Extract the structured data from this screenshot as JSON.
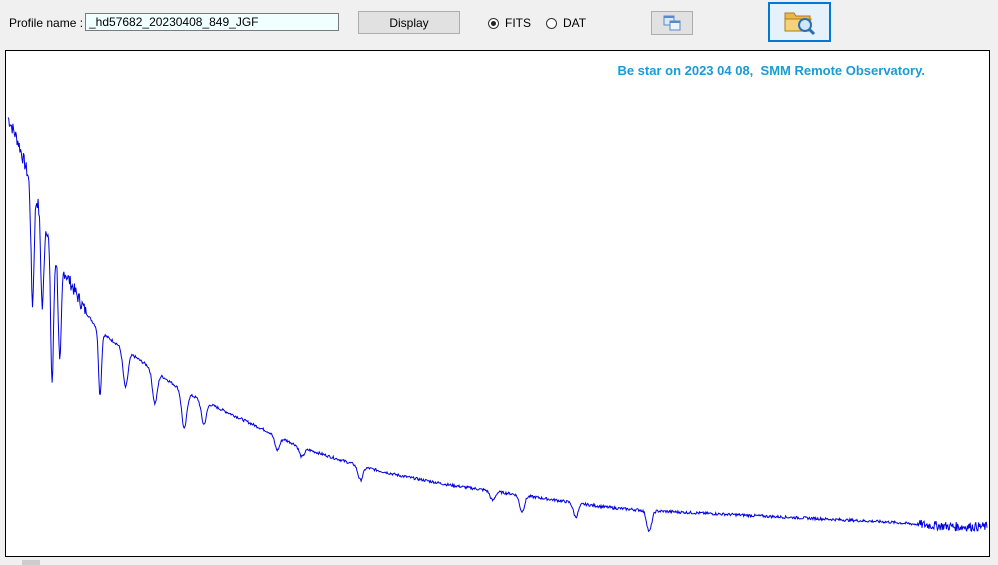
{
  "toolbar": {
    "profile_label": "Profile name :",
    "profile_value": "_hd57682_20230408_849_JGF",
    "display_label": "Display",
    "format_options": [
      {
        "label": "FITS",
        "selected": true
      },
      {
        "label": "DAT",
        "selected": false
      }
    ],
    "copy_icon": "copy-windows-icon",
    "open_icon": "folder-search-icon",
    "accent_color": "#0078d7"
  },
  "plot": {
    "title": "Be star on 2023 04 08,  SMM Remote Observatory.",
    "title_color": "#1a9ad6",
    "line_color": "#0000e0"
  },
  "chart_data": {
    "type": "line",
    "title": "Be star on 2023 04 08,  SMM Remote Observatory.",
    "xlabel": "",
    "ylabel": "",
    "grid": false,
    "axes_visible": false,
    "x_unit": "relative position (0-1)",
    "y_unit": "relative flux (0-1)",
    "x": [
      0.0,
      0.01,
      0.02,
      0.03,
      0.04,
      0.05,
      0.06,
      0.07,
      0.08,
      0.09,
      0.1,
      0.12,
      0.14,
      0.16,
      0.18,
      0.2,
      0.22,
      0.24,
      0.26,
      0.28,
      0.3,
      0.33,
      0.36,
      0.4,
      0.45,
      0.5,
      0.55,
      0.6,
      0.62,
      0.65,
      0.7,
      0.75,
      0.8,
      0.85,
      0.9,
      0.93,
      0.95,
      0.97,
      1.0
    ],
    "y": [
      0.9,
      0.85,
      0.78,
      0.72,
      0.66,
      0.6,
      0.56,
      0.52,
      0.48,
      0.45,
      0.43,
      0.4,
      0.37,
      0.34,
      0.31,
      0.29,
      0.27,
      0.25,
      0.23,
      0.21,
      0.19,
      0.17,
      0.15,
      0.13,
      0.11,
      0.095,
      0.08,
      0.065,
      0.06,
      0.055,
      0.05,
      0.045,
      0.04,
      0.035,
      0.03,
      0.025,
      0.022,
      0.02,
      0.02
    ],
    "absorption_lines": [
      {
        "x": 0.025,
        "depth": 0.25
      },
      {
        "x": 0.035,
        "depth": 0.2
      },
      {
        "x": 0.045,
        "depth": 0.3
      },
      {
        "x": 0.053,
        "depth": 0.22
      },
      {
        "x": 0.094,
        "depth": 0.14
      },
      {
        "x": 0.12,
        "depth": 0.08
      },
      {
        "x": 0.15,
        "depth": 0.07
      },
      {
        "x": 0.18,
        "depth": 0.08
      },
      {
        "x": 0.2,
        "depth": 0.05
      },
      {
        "x": 0.275,
        "depth": 0.03
      },
      {
        "x": 0.3,
        "depth": 0.02
      },
      {
        "x": 0.36,
        "depth": 0.03
      },
      {
        "x": 0.495,
        "depth": 0.02
      },
      {
        "x": 0.525,
        "depth": 0.035
      },
      {
        "x": 0.58,
        "depth": 0.03
      },
      {
        "x": 0.655,
        "depth": 0.045
      }
    ]
  }
}
